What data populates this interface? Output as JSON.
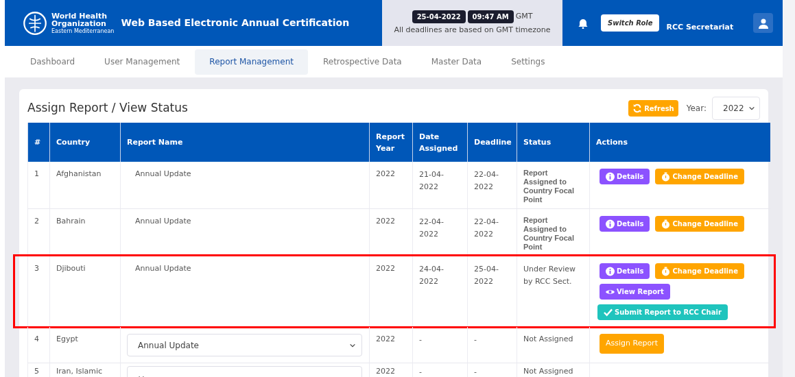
{
  "header": {
    "logo_text": [
      "World Health",
      "Organization",
      "Eastern Mediterranean"
    ],
    "app_title": "Web Based Electronic Annual Certification",
    "date": "25-04-2022",
    "time": "09:47 AM",
    "timezone": "GMT",
    "note": "All deadlines are based on GMT timezone",
    "switch_role": "Switch Role",
    "role": "RCC Secretariat"
  },
  "nav": [
    {
      "label": "Dashboard",
      "selected": false
    },
    {
      "label": "User Management",
      "selected": false
    },
    {
      "label": "Report Management",
      "selected": true
    },
    {
      "label": "Retrospective Data",
      "selected": false
    },
    {
      "label": "Master Data",
      "selected": false
    },
    {
      "label": "Settings",
      "selected": false
    }
  ],
  "card": {
    "title": "Assign Report / View Status",
    "refresh": "Refresh",
    "year_label": "Year:",
    "year": "2022"
  },
  "table": {
    "columns": [
      "#",
      "Country",
      "Report Name",
      "Report Year",
      "Date Assigned",
      "Deadline",
      "Status",
      "Actions"
    ],
    "rows": [
      {
        "kind": "assigned",
        "highlighted": false,
        "num": "1",
        "country": "Afghanistan",
        "report": "Annual Update",
        "year": "2022",
        "assigned": "21-04-2022",
        "deadline": "22-04-2022",
        "status": "Report Assigned to Country Focal Point",
        "actions": [
          {
            "kind": "details",
            "label": "Details"
          },
          {
            "kind": "deadline",
            "label": "Change Deadline"
          }
        ]
      },
      {
        "kind": "assigned",
        "highlighted": false,
        "num": "2",
        "country": "Bahrain",
        "report": "Annual Update",
        "year": "2022",
        "assigned": "22-04-2022",
        "deadline": "22-04-2022",
        "status": "Report Assigned to Country Focal Point",
        "actions": [
          {
            "kind": "details",
            "label": "Details"
          },
          {
            "kind": "deadline",
            "label": "Change Deadline"
          }
        ]
      },
      {
        "kind": "review",
        "highlighted": true,
        "num": "3",
        "country": "Djibouti",
        "report": "Annual Update",
        "year": "2022",
        "assigned": "24-04-2022",
        "deadline": "25-04-2022",
        "status": "Under Review by RCC Sect.",
        "actions": [
          {
            "kind": "details",
            "label": "Details"
          },
          {
            "kind": "deadline",
            "label": "Change Deadline"
          },
          {
            "kind": "view",
            "label": "View Report"
          },
          {
            "kind": "submit",
            "label": "Submit Report to RCC Chair"
          }
        ]
      },
      {
        "kind": "unassigned",
        "highlighted": false,
        "num": "4",
        "country": "Egypt",
        "report": "Annual Update",
        "year": "2022",
        "assigned": "-",
        "deadline": "-",
        "status": "Not Assigned",
        "actions": [
          {
            "kind": "assign",
            "label": "Assign Report"
          }
        ]
      },
      {
        "kind": "unassigned",
        "highlighted": false,
        "num": "5",
        "country": "Iran, Islamic",
        "year": "2022",
        "assigned": "-",
        "deadline": "-",
        "status": "Not Assigned"
      }
    ]
  }
}
